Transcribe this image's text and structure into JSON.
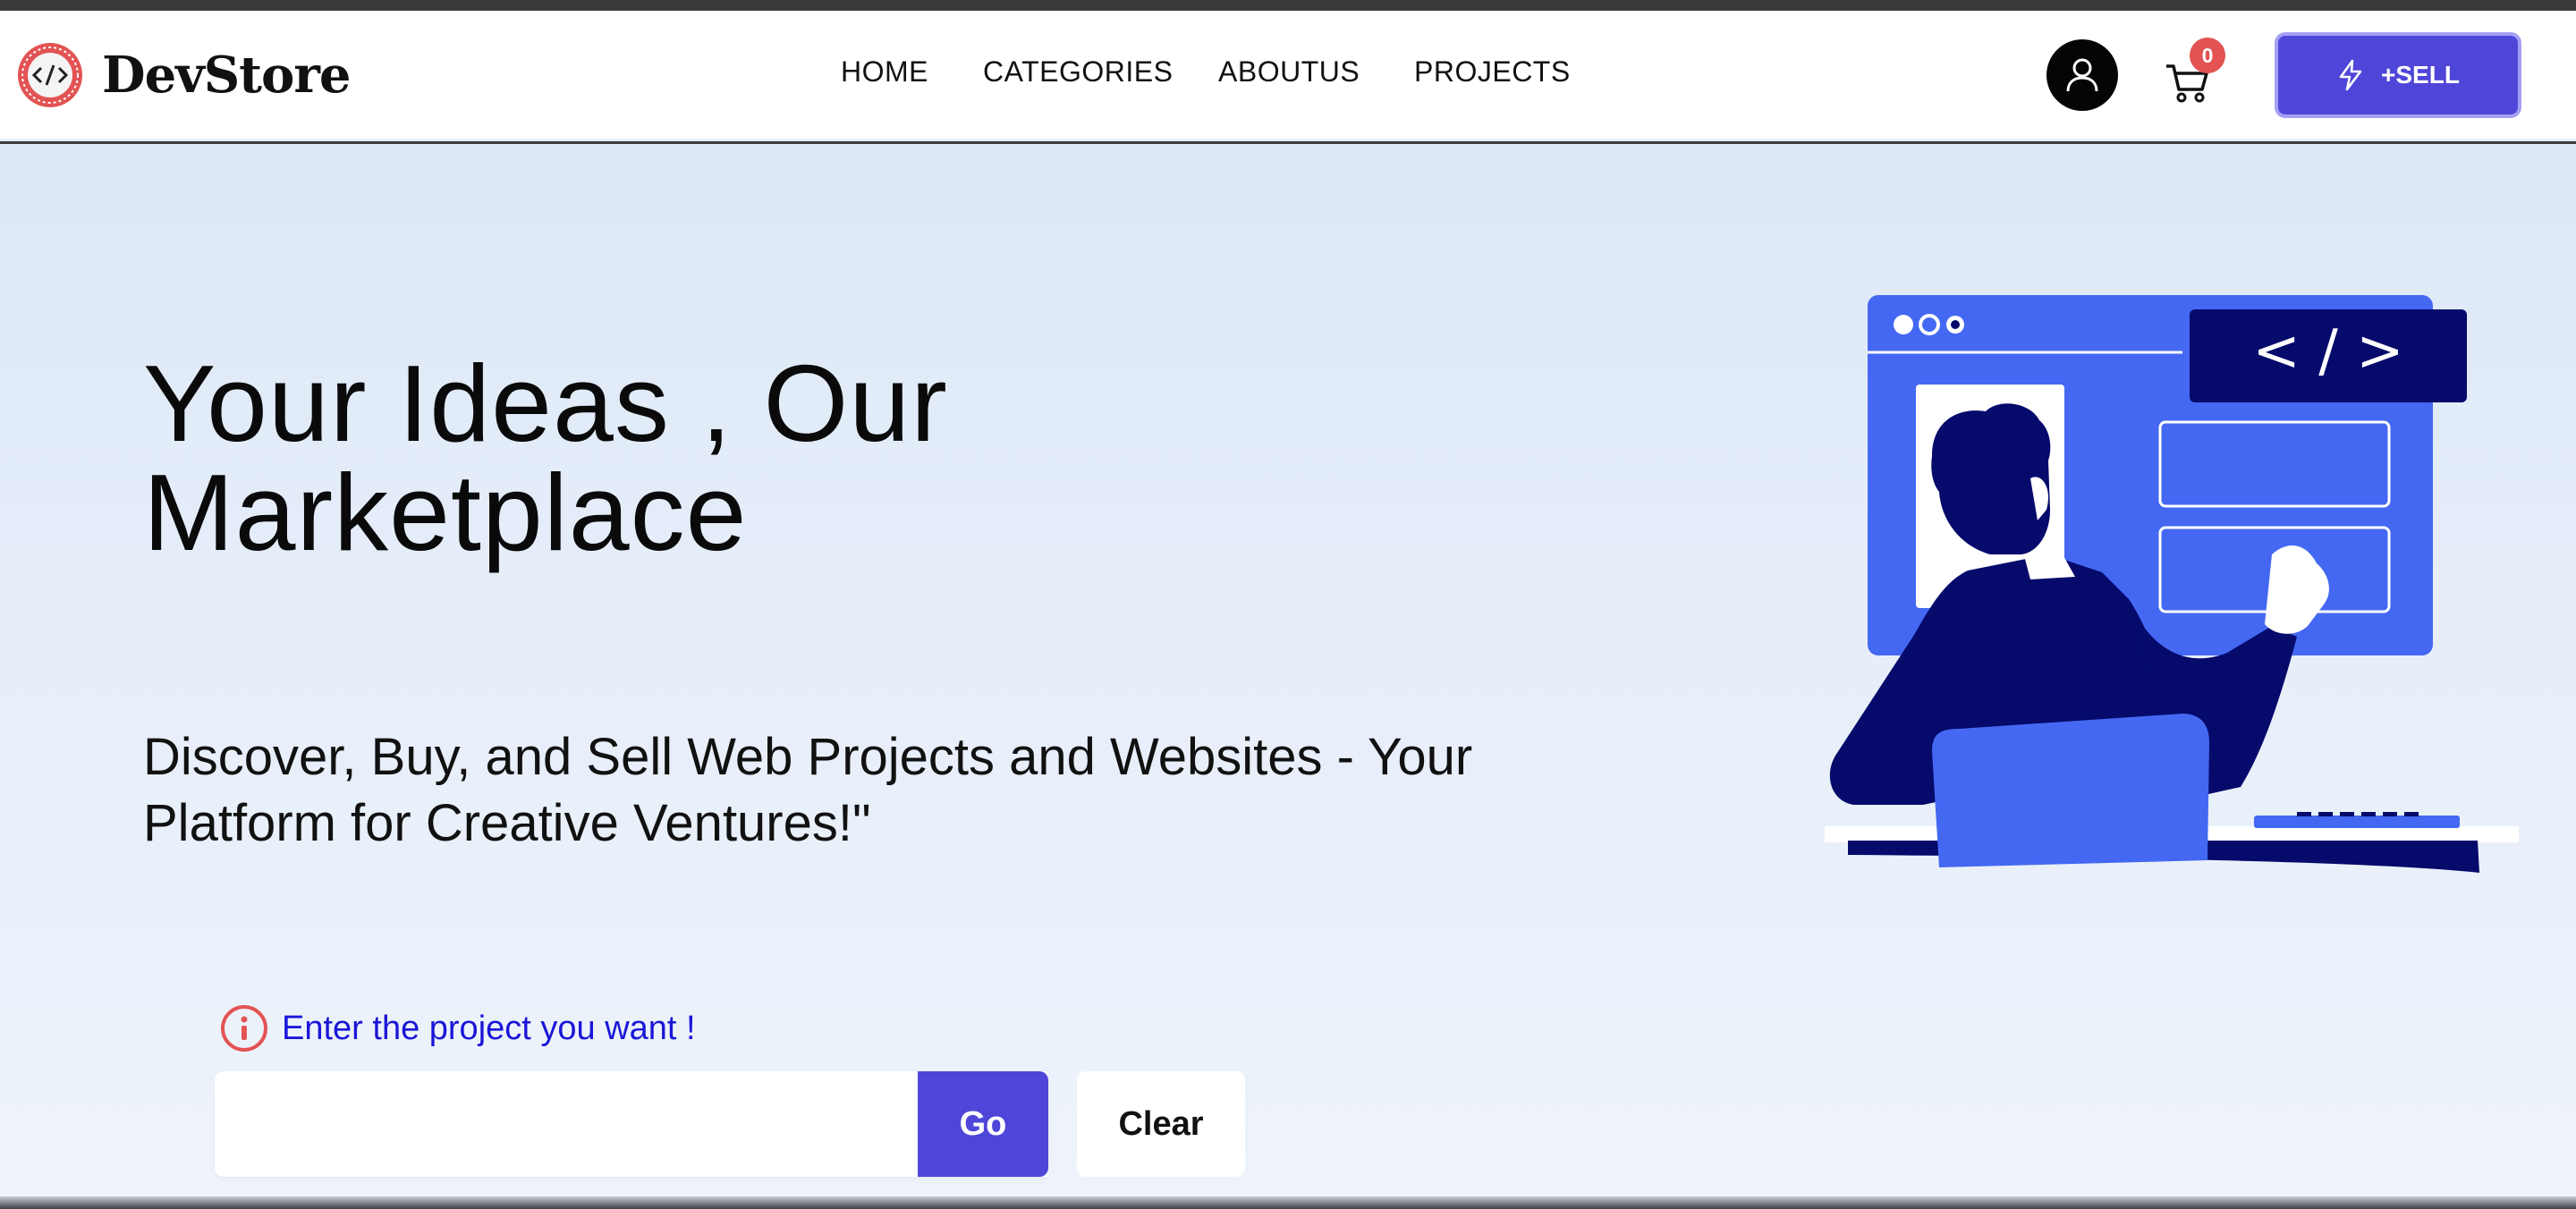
{
  "brand": {
    "name": "DevStore",
    "logo_icon": "code-brackets-icon"
  },
  "nav": {
    "links": [
      "HOME",
      "CATEGORIES",
      "ABOUTUS",
      "PROJECTS"
    ]
  },
  "header_actions": {
    "profile_icon": "user-icon",
    "cart_icon": "cart-icon",
    "cart_count": "0",
    "sell_label": "+SELL",
    "sell_icon": "lightning-icon"
  },
  "hero": {
    "headline": "Your Ideas , Our Marketplace",
    "subline": "Discover, Buy, and Sell Web Projects and Websites - Your Platform for Creative Ventures!\"",
    "illustration_code_label": "< / >"
  },
  "search": {
    "hint_icon": "info-icon",
    "hint_text": "Enter the project you want !",
    "input_value": "",
    "placeholder": "",
    "go_label": "Go",
    "clear_label": "Clear"
  },
  "colors": {
    "accent": "#4f46d9",
    "hint_text": "#1a16d8",
    "badge": "#e35353",
    "illustration_blue": "#4468f2",
    "illustration_navy": "#050a6b"
  }
}
